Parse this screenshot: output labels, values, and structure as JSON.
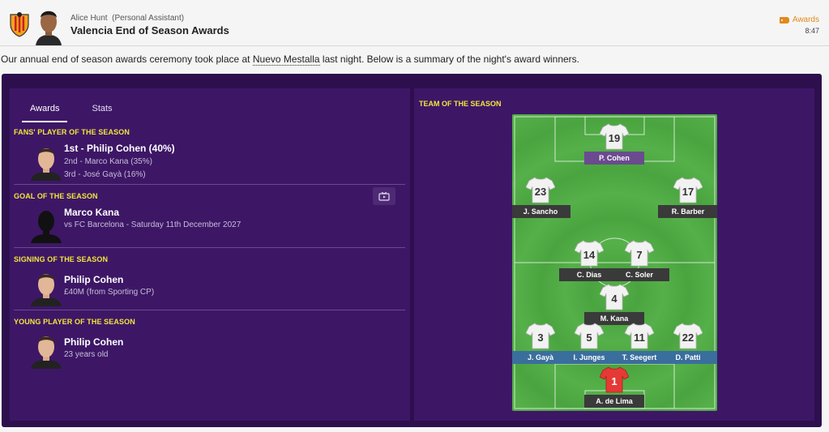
{
  "header": {
    "sender": "Alice Hunt",
    "sender_role": "(Personal Assistant)",
    "subject": "Valencia End of Season Awards",
    "tag": "Awards",
    "time": "8:47"
  },
  "intro": {
    "before": "Our annual end of season awards ceremony took place at ",
    "stadium": "Nuevo Mestalla",
    "after": " last night. Below is a summary of the night's award winners."
  },
  "tabs": [
    "Awards",
    "Stats"
  ],
  "awards": {
    "fans": {
      "title": "FANS' PLAYER OF THE SEASON",
      "first": "1st - Philip Cohen (40%)",
      "second": "2nd - Marco Kana (35%)",
      "third": "3rd - José Gayà (16%)"
    },
    "goal": {
      "title": "GOAL OF THE SEASON",
      "player": "Marco Kana",
      "detail": "vs FC Barcelona - Saturday 11th December 2027"
    },
    "signing": {
      "title": "SIGNING OF THE SEASON",
      "player": "Philip Cohen",
      "detail": "£40M (from Sporting CP)"
    },
    "young": {
      "title": "YOUNG PLAYER OF THE SEASON",
      "player": "Philip Cohen",
      "detail": "23 years old"
    }
  },
  "team": {
    "title": "TEAM OF THE SEASON",
    "players": [
      {
        "number": "19",
        "name": "P. Cohen",
        "tag_color": "purple"
      },
      {
        "number": "23",
        "name": "J. Sancho",
        "tag_color": "dark"
      },
      {
        "number": "17",
        "name": "R. Barber",
        "tag_color": "dark"
      },
      {
        "number": "14",
        "name": "C. Dias",
        "tag_color": "dark"
      },
      {
        "number": "7",
        "name": "C. Soler",
        "tag_color": "dark"
      },
      {
        "number": "4",
        "name": "M. Kana",
        "tag_color": "dark"
      },
      {
        "number": "3",
        "name": "J. Gayà",
        "tag_color": "blue"
      },
      {
        "number": "5",
        "name": "I. Junges",
        "tag_color": "blue"
      },
      {
        "number": "11",
        "name": "T. Seegert",
        "tag_color": "blue"
      },
      {
        "number": "22",
        "name": "D. Patti",
        "tag_color": "blue"
      },
      {
        "number": "1",
        "name": "A. de Lima",
        "tag_color": "dark",
        "goalkeeper": true
      }
    ]
  },
  "colors": {
    "panel_bg": "#2e0f4e",
    "card_bg": "#3d1766",
    "section_title": "#f2e53c",
    "tag_accent": "#e08a1e",
    "pitch_green": "#4aa43f"
  }
}
